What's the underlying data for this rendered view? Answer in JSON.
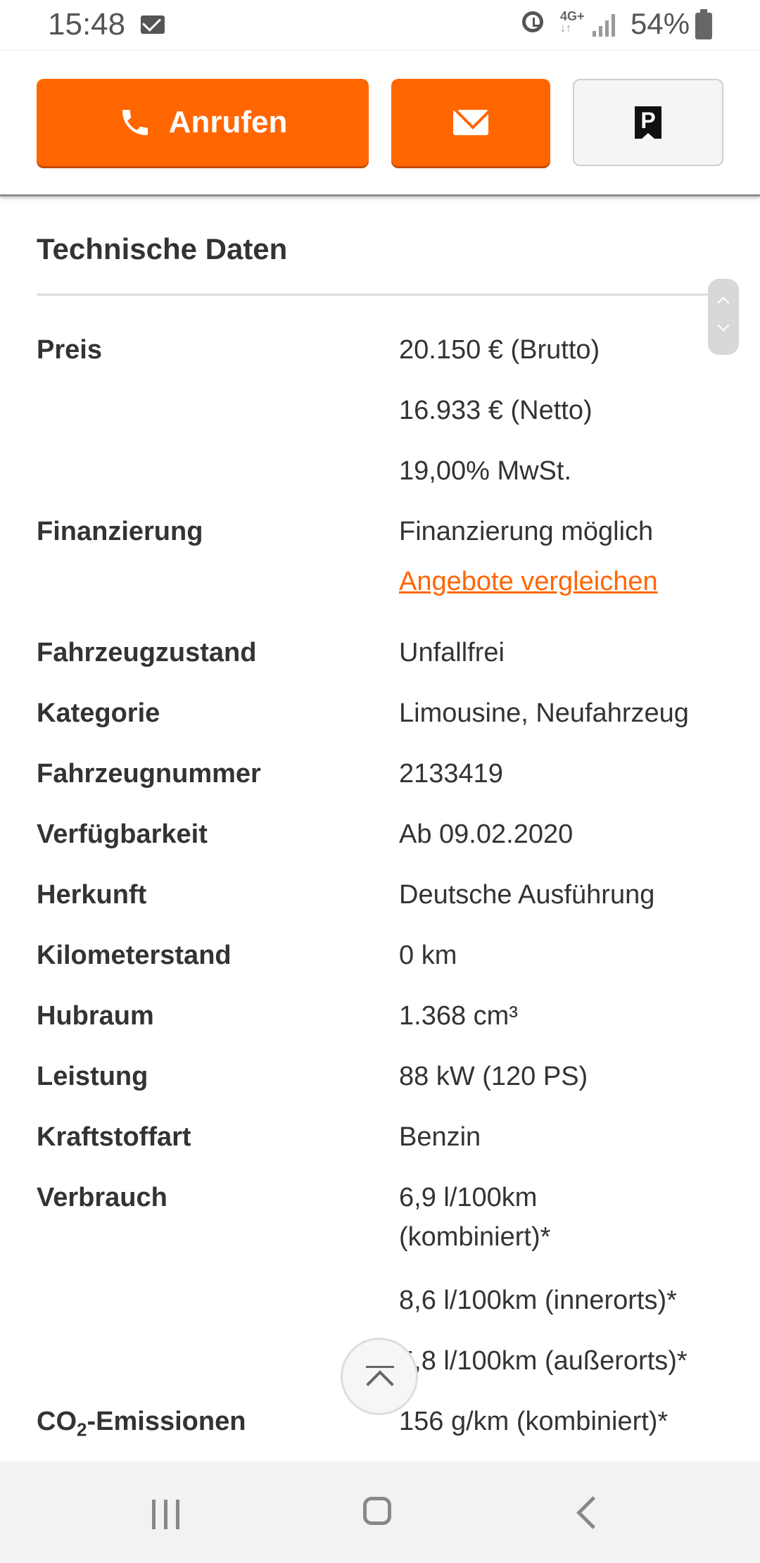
{
  "status_bar": {
    "time": "15:48",
    "network": "4G+",
    "battery": "54%"
  },
  "actions": {
    "call_label": "Anrufen"
  },
  "section": {
    "title": "Technische Daten"
  },
  "specs": {
    "preis": {
      "label": "Preis",
      "values": [
        "20.150 € (Brutto)",
        "16.933 € (Netto)",
        "19,00% MwSt."
      ]
    },
    "finanzierung": {
      "label": "Finanzierung",
      "value": "Finanzierung möglich",
      "link": "Angebote vergleichen"
    },
    "zustand": {
      "label": "Fahrzeugzustand",
      "value": "Unfallfrei"
    },
    "kategorie": {
      "label": "Kategorie",
      "value": "Limousine, Neufahrzeug"
    },
    "nummer": {
      "label": "Fahrzeugnummer",
      "value": "2133419"
    },
    "verfuegbarkeit": {
      "label": "Verfügbarkeit",
      "value": "Ab 09.02.2020"
    },
    "herkunft": {
      "label": "Herkunft",
      "value": "Deutsche Ausführung"
    },
    "kilometer": {
      "label": "Kilometerstand",
      "value": "0 km"
    },
    "hubraum": {
      "label": "Hubraum",
      "value": "1.368 cm³"
    },
    "leistung": {
      "label": "Leistung",
      "value": "88 kW (120 PS)"
    },
    "kraftstoff": {
      "label": "Kraftstoffart",
      "value": "Benzin"
    },
    "verbrauch": {
      "label": "Verbrauch",
      "values": [
        "6,9 l/100km",
        "(kombiniert)*",
        "8,6 l/100km (innerorts)*",
        "5,8 l/100km (außerorts)*"
      ]
    },
    "co2": {
      "label_main": "CO",
      "label_sub": "2",
      "label_rest": "-Emissionen",
      "value": "156 g/km (kombiniert)*"
    }
  }
}
